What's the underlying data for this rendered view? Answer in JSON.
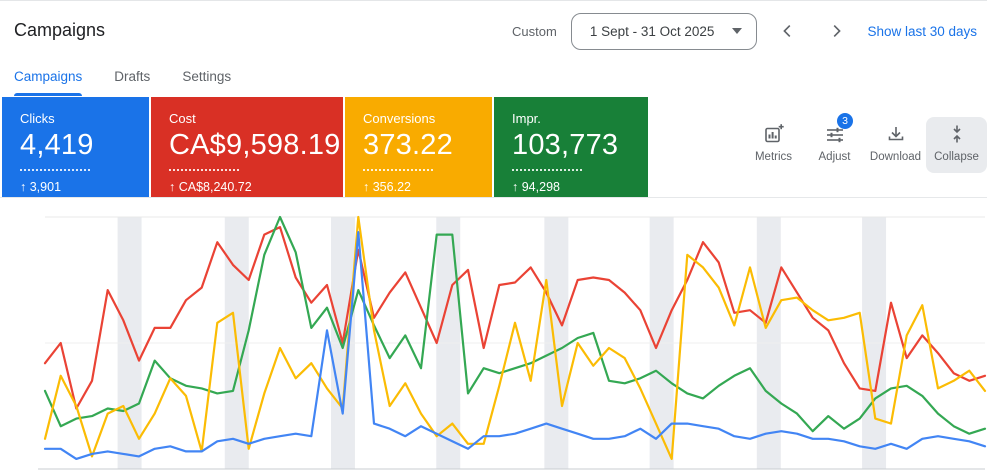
{
  "header": {
    "title": "Campaigns",
    "date_mode_label": "Custom",
    "date_range": "1 Sept - 31 Oct 2025",
    "show_last_link": "Show last 30 days",
    "icons": [
      "dropdown-caret-icon",
      "chevron-left-icon",
      "chevron-right-icon"
    ]
  },
  "tabs": [
    {
      "label": "Campaigns",
      "active": true
    },
    {
      "label": "Drafts",
      "active": false
    },
    {
      "label": "Settings",
      "active": false
    }
  ],
  "scorecards": [
    {
      "label": "Clicks",
      "value": "4,419",
      "delta_arrow": "↑",
      "delta": "3,901",
      "color": "#1a73e8"
    },
    {
      "label": "Cost",
      "value": "CA$9,598.19",
      "delta_arrow": "↑",
      "delta": "CA$8,240.72",
      "color": "#d93025"
    },
    {
      "label": "Conversions",
      "value": "373.22",
      "delta_arrow": "↑",
      "delta": "356.22",
      "color": "#f9ab00"
    },
    {
      "label": "Impr.",
      "value": "103,773",
      "delta_arrow": "↑",
      "delta": "94,298",
      "color": "#188038"
    }
  ],
  "toolbar": [
    {
      "label": "Metrics",
      "icon": "metrics-icon"
    },
    {
      "label": "Adjust",
      "icon": "adjust-icon",
      "badge": "3"
    },
    {
      "label": "Download",
      "icon": "download-icon"
    },
    {
      "label": "Collapse",
      "icon": "collapse-icon",
      "active": true
    }
  ],
  "chart_data": {
    "type": "line",
    "title": "Campaign performance over time (1 Sept - 31 Oct 2025)",
    "xlabel": "",
    "ylabel": "",
    "x_points": 61,
    "axis_labels_visible": false,
    "ylim": [
      0,
      100
    ],
    "value_unit": "percent of plot height (no numeric axis shown in screenshot)",
    "grid": {
      "horizontal_gridlines": 3,
      "weekly_shaded_bands": true
    },
    "band_centers_pct": [
      9.0,
      20.4,
      31.7,
      42.9,
      54.4,
      65.6,
      77.0,
      88.2
    ],
    "band_width_pct": 1.7,
    "series": [
      {
        "name": "Clicks",
        "color": "#4285f4",
        "values": [
          8,
          8,
          4,
          6,
          7,
          6,
          5,
          8,
          9,
          7,
          7,
          11,
          12,
          10,
          12,
          13,
          14,
          13,
          55,
          22,
          94,
          18,
          16,
          13,
          17,
          14,
          11,
          8,
          13,
          13,
          14,
          16,
          18,
          16,
          14,
          12,
          12,
          13,
          16,
          12,
          18,
          18,
          17,
          16,
          13,
          12,
          14,
          15,
          14,
          12,
          12,
          11,
          9,
          8,
          10,
          8,
          12,
          13,
          12,
          11,
          9
        ]
      },
      {
        "name": "Cost",
        "color": "#ea4335",
        "values": [
          42,
          50,
          24,
          35,
          71,
          59,
          43,
          56,
          56,
          67,
          72,
          90,
          81,
          75,
          93,
          96,
          76,
          66,
          73,
          50,
          87,
          60,
          70,
          78,
          64,
          50,
          73,
          79,
          48,
          73,
          74,
          80,
          70,
          57,
          75,
          76,
          75,
          70,
          63,
          48,
          63,
          75,
          90,
          82,
          62,
          63,
          58,
          80,
          70,
          60,
          55,
          42,
          32,
          31,
          66,
          44,
          53,
          46,
          38,
          35,
          37
        ]
      },
      {
        "name": "Conversions",
        "color": "#fbbc04",
        "values": [
          12,
          37,
          25,
          5,
          22,
          25,
          12,
          22,
          36,
          29,
          7,
          58,
          62,
          8,
          30,
          48,
          36,
          42,
          32,
          24,
          100,
          55,
          25,
          34,
          22,
          13,
          18,
          10,
          10,
          33,
          58,
          35,
          75,
          25,
          50,
          41,
          48,
          44,
          32,
          18,
          4,
          85,
          80,
          72,
          57,
          80,
          56,
          67,
          68,
          63,
          59,
          60,
          62,
          20,
          18,
          53,
          65,
          32,
          35,
          39,
          31
        ]
      },
      {
        "name": "Impressions",
        "color": "#34a853",
        "values": [
          31,
          17,
          20,
          21,
          24,
          23,
          26,
          43,
          36,
          33,
          32,
          30,
          31,
          55,
          85,
          100,
          86,
          56,
          64,
          48,
          71,
          57,
          44,
          53,
          40,
          93,
          93,
          30,
          40,
          38,
          40,
          42,
          45,
          48,
          52,
          54,
          35,
          34,
          36,
          39,
          34,
          30,
          28,
          33,
          37,
          40,
          31,
          26,
          22,
          15,
          21,
          16,
          20,
          28,
          32,
          33,
          29,
          22,
          17,
          14,
          16
        ]
      }
    ]
  }
}
